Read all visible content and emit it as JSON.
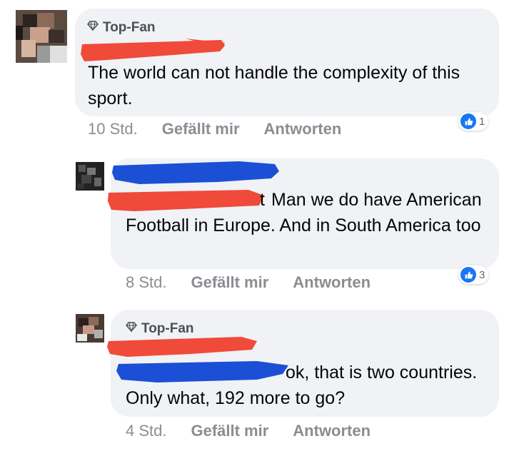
{
  "comments": [
    {
      "badge": "Top-Fan",
      "text": "The world can not handle the complexity of this sport.",
      "time": "10 Std.",
      "like_label": "Gefällt mir",
      "reply_label": "Antworten",
      "likes": "1"
    },
    {
      "badge": "",
      "text_partial_tail": "t",
      "text": "Man we do have American Football in Europe. And in South America too",
      "time": "8 Std.",
      "like_label": "Gefällt mir",
      "reply_label": "Antworten",
      "likes": "3"
    },
    {
      "badge": "Top-Fan",
      "text": "ok, that is two countries.  Only what, 192 more to go?",
      "time": "4 Std.",
      "like_label": "Gefällt mir",
      "reply_label": "Antworten",
      "likes": ""
    }
  ],
  "colors": {
    "bubble": "#f0f2f5",
    "like_blue": "#1877f2",
    "redact_red": "#f04a3a",
    "redact_blue": "#1b4fd6"
  },
  "icons": [
    "diamond-icon",
    "thumbs-up-icon"
  ]
}
